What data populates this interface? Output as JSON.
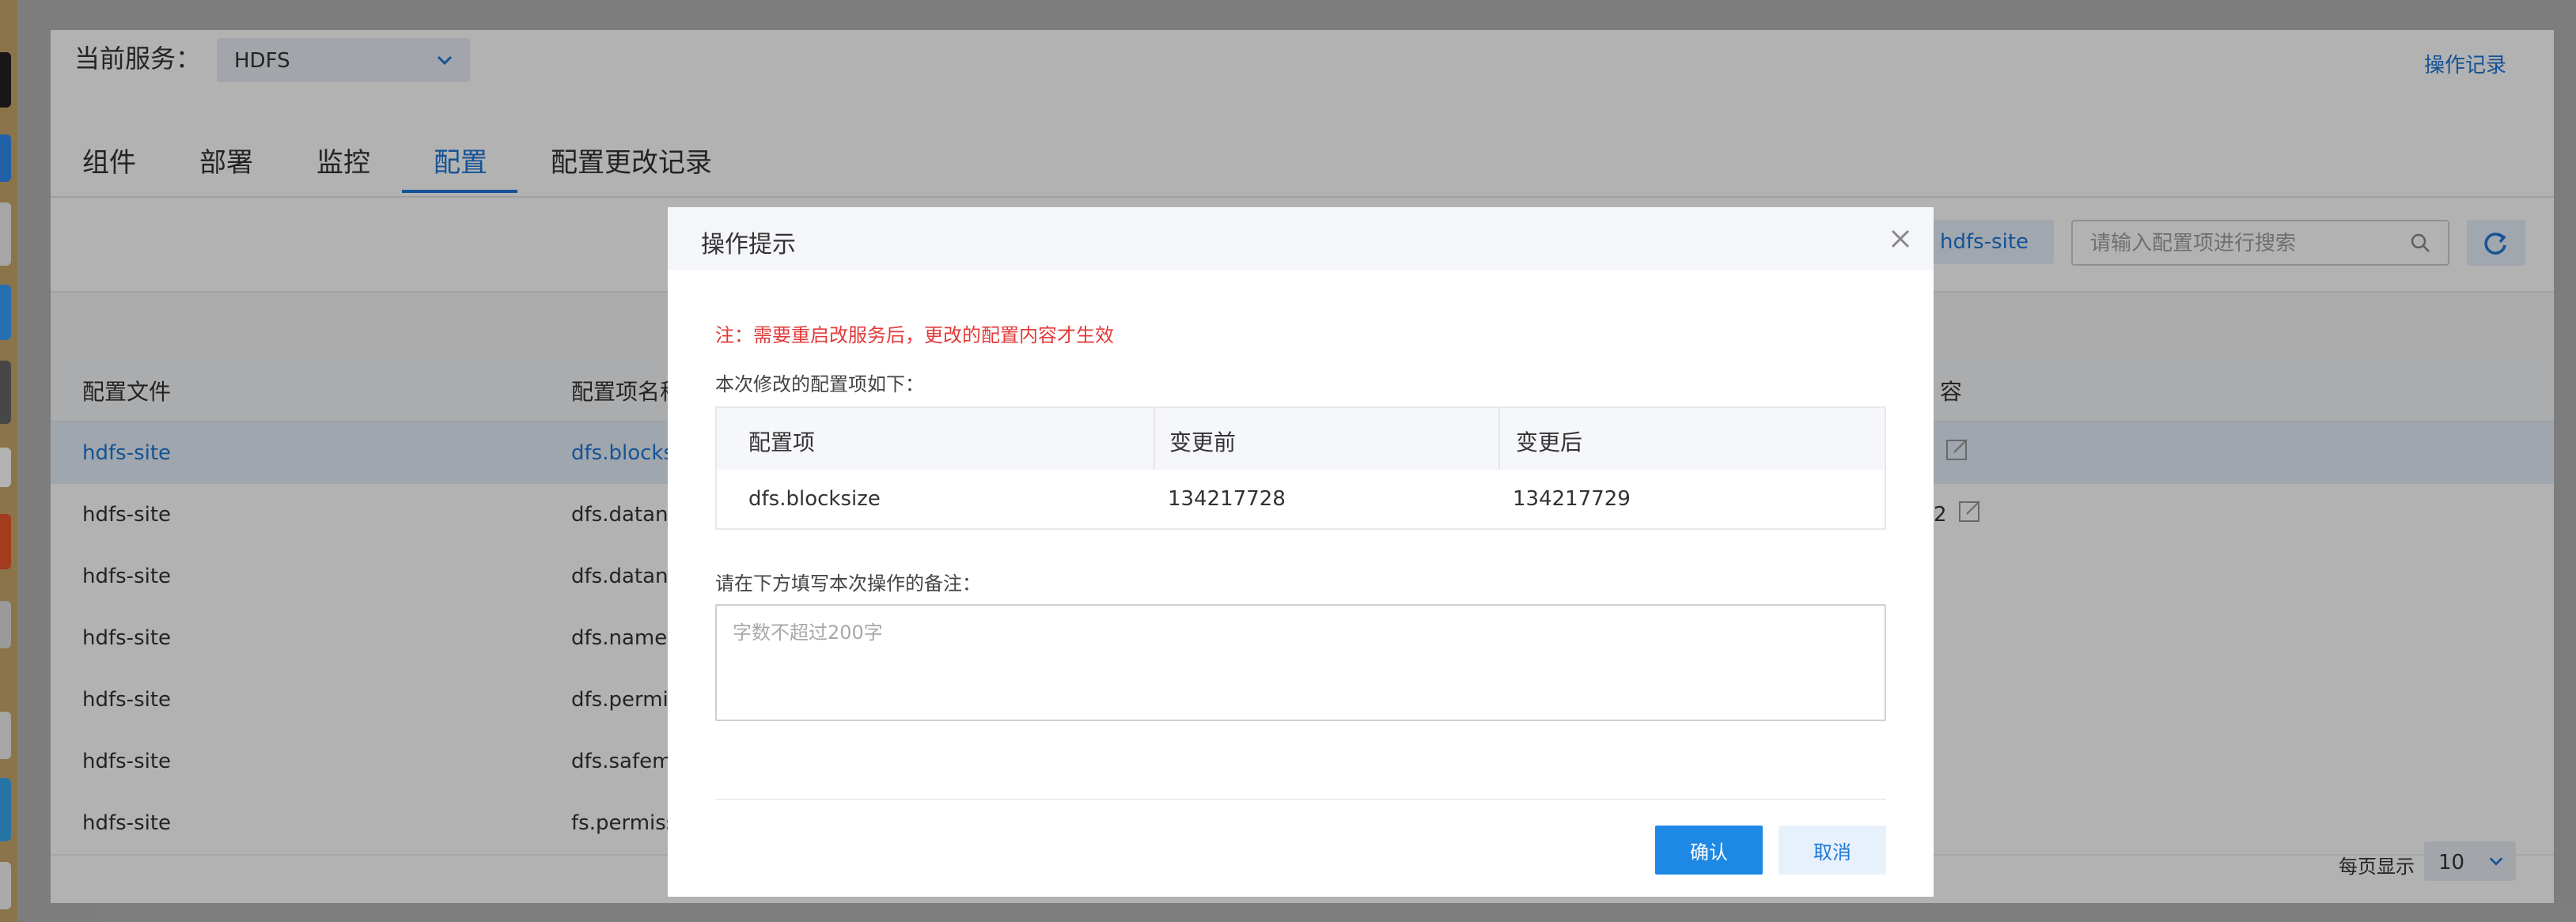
{
  "header": {
    "service_label": "当前服务：",
    "service_value": "HDFS",
    "operation_log": "操作记录"
  },
  "tabs": [
    {
      "label": "组件"
    },
    {
      "label": "部署"
    },
    {
      "label": "监控"
    },
    {
      "label": "配置",
      "active": true
    },
    {
      "label": "配置更改记录"
    }
  ],
  "toolbar": {
    "file_filter": "hdfs-site",
    "search_placeholder": "请输入配置项进行搜索"
  },
  "table": {
    "headers": [
      "配置文件",
      "配置项名称",
      "容"
    ],
    "rows": [
      {
        "file": "hdfs-site",
        "key": "dfs.blocksi",
        "extra": ""
      },
      {
        "file": "hdfs-site",
        "key": "dfs.datanoc",
        "extra": "2"
      },
      {
        "file": "hdfs-site",
        "key": "dfs.datanoc",
        "extra": ""
      },
      {
        "file": "hdfs-site",
        "key": "dfs.namenc",
        "extra": ""
      },
      {
        "file": "hdfs-site",
        "key": "dfs.permiss",
        "extra": ""
      },
      {
        "file": "hdfs-site",
        "key": "dfs.safemo",
        "extra": ""
      },
      {
        "file": "hdfs-site",
        "key": "fs.permissi",
        "extra": ""
      }
    ]
  },
  "pager": {
    "label": "每页显示",
    "value": "10"
  },
  "modal": {
    "title": "操作提示",
    "warning": "注：需要重启改服务后，更改的配置内容才生效",
    "subtitle": "本次修改的配置项如下：",
    "columns": [
      "配置项",
      "变更前",
      "变更后"
    ],
    "change": {
      "key": "dfs.blocksize",
      "before": "134217728",
      "after": "134217729"
    },
    "remark_label": "请在下方填写本次操作的备注：",
    "remark_placeholder": "字数不超过200字",
    "confirm": "确认",
    "cancel": "取消"
  },
  "colors": {
    "accent": "#1e78d7",
    "warning": "#e33a3a",
    "primary_button": "#1e88e5"
  }
}
